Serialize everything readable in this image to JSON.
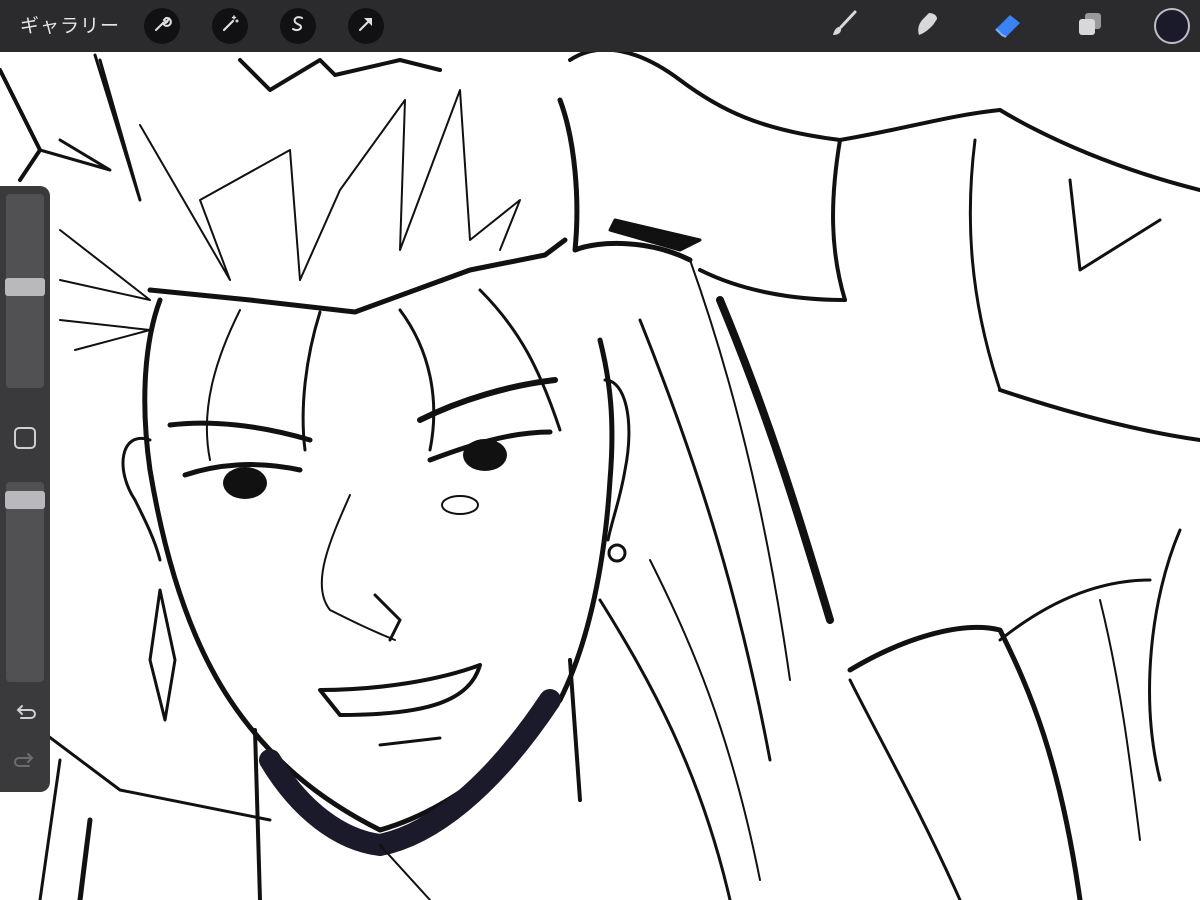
{
  "toolbar": {
    "gallery_label": "ギャラリー",
    "left_tools": [
      "wrench-icon",
      "magic-wand-icon",
      "selection-icon",
      "transform-arrow-icon"
    ],
    "right_tools": [
      "brush-icon",
      "smudge-icon",
      "eraser-icon",
      "layers-icon"
    ],
    "active_tool": "eraser",
    "current_color": "#1a1a2a"
  },
  "sidebar": {
    "brush_size_level": 0.52,
    "opacity_level": 0.95,
    "controls": [
      "brush-size-slider",
      "modify-button",
      "opacity-slider",
      "undo-icon",
      "redo-icon"
    ]
  },
  "colors": {
    "toolbar_bg": "#2b2b2d",
    "sidebar_bg": "#3a3a3c",
    "active_accent": "#3b82f6",
    "canvas": "#ffffff",
    "ink": "#111111"
  }
}
